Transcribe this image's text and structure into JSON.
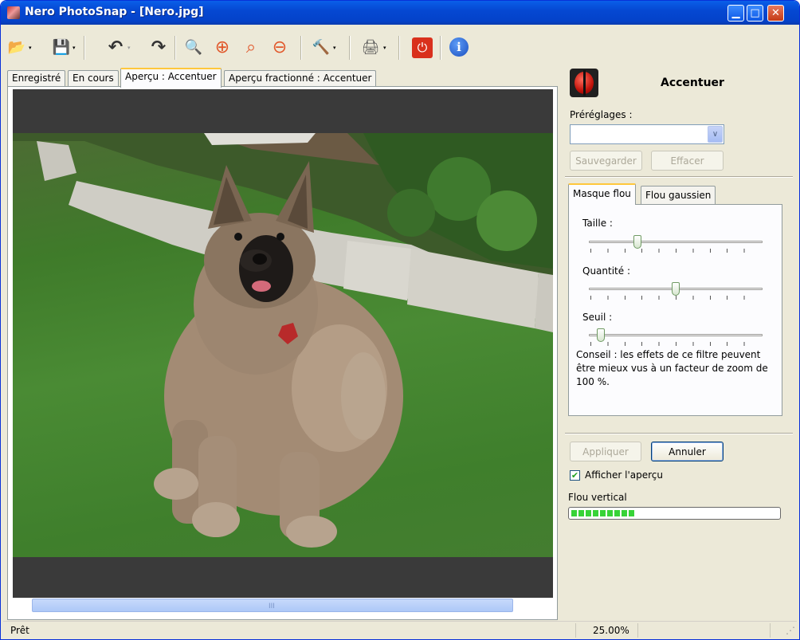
{
  "window": {
    "title": "Nero PhotoSnap - [Nero.jpg]",
    "minimize": "▁",
    "maximize": "□",
    "close": "✕"
  },
  "toolbar": {
    "open_glyph": "📂",
    "save_glyph": "💾",
    "undo_glyph": "↶",
    "redo_glyph": "↷",
    "view_page_glyph": "🔍",
    "zoom_in_glyph": "⊕",
    "zoom_fit_glyph": "⌕",
    "zoom_out_glyph": "⊖",
    "tools_glyph": "🔨",
    "print_glyph": "🖨",
    "exit_glyph": "⏻",
    "about_glyph": "ℹ",
    "dropdown_glyph": "▾"
  },
  "tabs": [
    {
      "label": "Enregistré"
    },
    {
      "label": "En cours"
    },
    {
      "label": "Aperçu : Accentuer"
    },
    {
      "label": "Aperçu fractionné : Accentuer"
    }
  ],
  "viewer": {
    "scroll_grip": "III"
  },
  "panel": {
    "title": "Accentuer",
    "presets_label": "Préréglages :",
    "presets_value": "",
    "combo_arrow": "∨",
    "save_label": "Sauvegarder",
    "delete_label": "Effacer",
    "tabs": [
      {
        "label": "Masque flou"
      },
      {
        "label": "Flou gaussien"
      }
    ],
    "sliders": [
      {
        "label": "Taille :",
        "value": 0.27
      },
      {
        "label": "Quantité :",
        "value": 0.5
      },
      {
        "label": "Seuil :",
        "value": 0.05
      }
    ],
    "tip": "Conseil : les effets de ce filtre peuvent être mieux vus à un facteur de zoom de 100 %.",
    "apply_label": "Appliquer",
    "cancel_label": "Annuler",
    "preview_checkbox_label": "Afficher l'aperçu",
    "preview_checked": true,
    "check_mark": "✔",
    "progress_label": "Flou vertical",
    "progress_value": 0.31
  },
  "status": {
    "text": "Prêt",
    "zoom": "25.00%",
    "grip": "⋰"
  }
}
